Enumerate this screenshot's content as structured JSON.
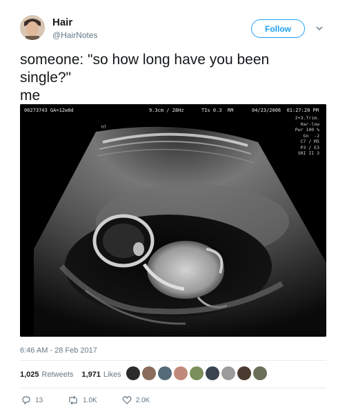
{
  "user": {
    "display_name": "Hair",
    "handle": "@HairNotes"
  },
  "follow_button": {
    "label": "Follow"
  },
  "tweet": {
    "text": "someone: \"so how long have you been\nsingle?\"\nme",
    "timestamp": "6:46 AM - 28 Feb 2017"
  },
  "media": {
    "hud_id": "06273743 GA=12w0d",
    "hud_depth": "9.3cm / 28Hz",
    "hud_tis": "TIs 0.3  RM",
    "hud_datetime": "04/23/2006  01:27:20 PM",
    "hud_lines": [
      "2+3.Trim.",
      "Har-low",
      "Pwr 100 %",
      "Gn  -2",
      "C7 / M5",
      "P3 / E3",
      "SRI II 3"
    ],
    "hud_side_label": "HT"
  },
  "stats": {
    "retweets_count": "1,025",
    "retweets_label": "Retweets",
    "likes_count": "1,971",
    "likes_label": "Likes"
  },
  "actions": {
    "reply_count": "13",
    "retweet_count": "1.0K",
    "like_count": "2.0K"
  },
  "colors": {
    "accent": "#1da1f2",
    "text_primary": "#14171a",
    "text_secondary": "#657786",
    "divider": "#e6ecf0"
  },
  "icons": {
    "follow_menu": "chevron-down-icon",
    "reply": "reply-icon",
    "retweet": "retweet-icon",
    "like": "heart-icon"
  }
}
